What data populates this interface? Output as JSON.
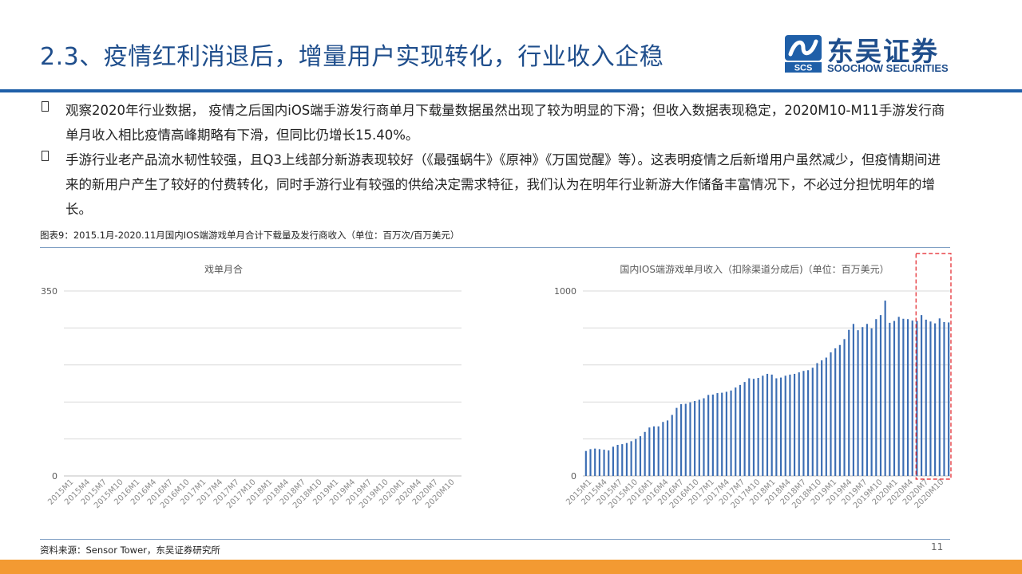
{
  "slide": {
    "title": "2.3、疫情红利消退后，增量用户实现转化，行业收入企稳",
    "page_number": "11"
  },
  "logo": {
    "name_cn": "东吴证券",
    "name_en": "SOOCHOW SECURITIES",
    "emblem_text": "SCS"
  },
  "bullets": [
    {
      "text": "观察2020年行业数据， 疫情之后国内iOS端手游发行商单月下载量数据虽然出现了较为明显的下滑；但收入数据表现稳定，2020M10-M11手游发行商单月收入相比疫情高峰期略有下滑，但同比仍增长15.40%。"
    },
    {
      "text": "手游行业老产品流水韧性较强，且Q3上线部分新游表现较好（《最强蜗牛》《原神》《万国觉醒》等）。这表明疫情之后新增用户虽然减少，但疫情期间进来的新用户产生了较好的付费转化，同时手游行业有较强的供给决定需求特征，我们认为在明年行业新游大作储备丰富情况下，不必过分担忧明年的增长。"
    }
  ],
  "figure": {
    "caption": "图表9：2015.1月-2020.11月国内IOS端游戏单月合计下载量及发行商收入（单位：百万次/百万美元）"
  },
  "source": {
    "text": "资料来源：Sensor Tower，东吴证券研究所"
  },
  "chart_data": [
    {
      "type": "bar",
      "title": "戏单月合",
      "ylim": [
        0,
        350
      ],
      "ytick_labels": [
        "0",
        "350"
      ],
      "grid": true,
      "xtick_labels": [
        "2015M1",
        "2015M4",
        "2015M7",
        "2015M10",
        "2016M1",
        "2016M4",
        "2016M7",
        "2016M10",
        "2017M1",
        "2017M4",
        "2017M7",
        "2017M10",
        "2018M1",
        "2018M4",
        "2018M7",
        "2018M10",
        "2019M1",
        "2019M4",
        "2019M7",
        "2019M10",
        "2020M1",
        "2020M4",
        "2020M7",
        "2020M10"
      ],
      "values": []
    },
    {
      "type": "bar",
      "title": "国内IOS端游戏单月收入（扣除渠道分成后)（单位：百万美元）",
      "ylim": [
        0,
        1000
      ],
      "ytick_labels": [
        "0",
        "1000"
      ],
      "grid": true,
      "xtick_labels": [
        "2015M1",
        "2015M4",
        "2015M7",
        "2015M10",
        "2016M1",
        "2016M4",
        "2016M7",
        "2016M10",
        "2017M1",
        "2017M4",
        "2017M7",
        "2017M10",
        "2018M1",
        "2018M4",
        "2018M7",
        "2018M10",
        "2019M1",
        "2019M4",
        "2019M7",
        "2019M10",
        "2020M1",
        "2020M4",
        "2020M7",
        "2020M10"
      ],
      "highlight": {
        "from": "2020M5",
        "to": "2020M11",
        "style": "red dashed box"
      },
      "values": [
        135,
        145,
        148,
        145,
        142,
        138,
        158,
        168,
        172,
        178,
        188,
        200,
        215,
        238,
        262,
        268,
        268,
        292,
        300,
        330,
        368,
        388,
        390,
        398,
        405,
        412,
        420,
        438,
        440,
        448,
        450,
        455,
        462,
        478,
        492,
        508,
        528,
        525,
        530,
        542,
        552,
        548,
        528,
        532,
        542,
        548,
        552,
        560,
        568,
        572,
        585,
        610,
        625,
        640,
        668,
        690,
        708,
        740,
        790,
        822,
        788,
        805,
        822,
        798,
        848,
        870,
        948,
        828,
        838,
        860,
        850,
        848,
        840,
        838,
        870,
        845,
        835,
        825,
        852,
        832,
        830
      ]
    }
  ]
}
